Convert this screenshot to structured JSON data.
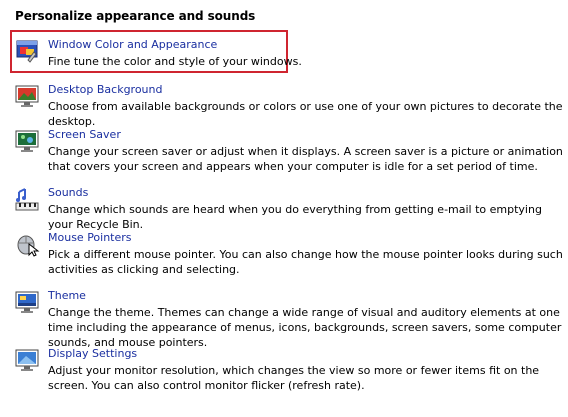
{
  "heading": "Personalize appearance and sounds",
  "colors": {
    "link": "#1a2fa0",
    "highlight": "#cf2530"
  },
  "items": [
    {
      "title": "Window Color and Appearance",
      "description": "Fine tune the color and style of your windows.",
      "icon": "window-color-icon",
      "highlighted": true
    },
    {
      "title": "Desktop Background",
      "description": "Choose from available backgrounds or colors or use one of your own pictures to decorate the desktop.",
      "icon": "desktop-background-icon"
    },
    {
      "title": "Screen Saver",
      "description": "Change your screen saver or adjust when it displays. A screen saver is a picture or animation that covers your screen and appears when your computer is idle for a set period of time.",
      "icon": "screen-saver-icon"
    },
    {
      "title": "Sounds",
      "description": "Change which sounds are heard when you do everything from getting e-mail to emptying your Recycle Bin.",
      "icon": "sounds-icon"
    },
    {
      "title": "Mouse Pointers",
      "description": "Pick a different mouse pointer. You can also change how the mouse pointer looks during such activities as clicking and selecting.",
      "icon": "mouse-pointers-icon"
    },
    {
      "title": "Theme",
      "description": "Change the theme. Themes can change a wide range of visual and auditory elements at one time including the appearance of menus, icons, backgrounds, screen savers, some computer sounds, and mouse pointers.",
      "icon": "theme-icon"
    },
    {
      "title": "Display Settings",
      "description": "Adjust your monitor resolution, which changes the view so more or fewer items fit on the screen. You can also control monitor flicker (refresh rate).",
      "icon": "display-settings-icon"
    }
  ]
}
